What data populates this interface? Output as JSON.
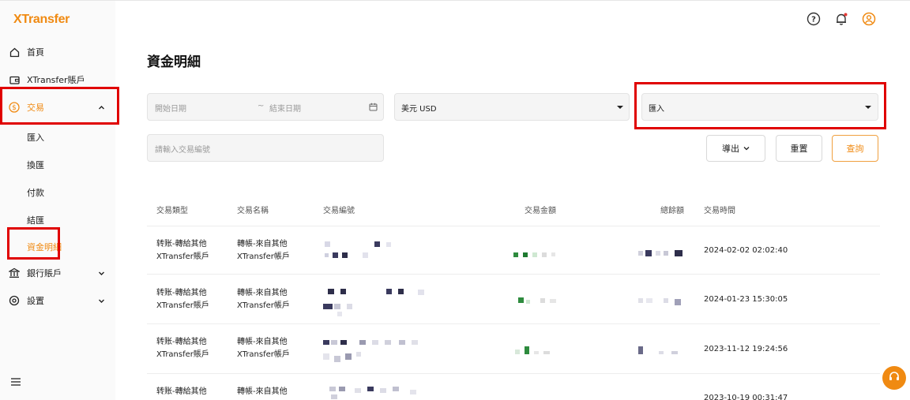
{
  "app": {
    "logo": "XTransfer"
  },
  "sidebar": {
    "items": [
      {
        "label": "首頁",
        "icon": "home-icon"
      },
      {
        "label": "XTransfer賬戶",
        "icon": "wallet-icon"
      },
      {
        "label": "交易",
        "icon": "dollar-circle-icon",
        "active": true,
        "expanded": true
      },
      {
        "label": "銀行賬戶",
        "icon": "bank-icon"
      },
      {
        "label": "設置",
        "icon": "settings-icon"
      }
    ],
    "sub_items": [
      {
        "label": "匯入"
      },
      {
        "label": "換匯"
      },
      {
        "label": "付款"
      },
      {
        "label": "結匯"
      },
      {
        "label": "資金明細",
        "active": true
      }
    ]
  },
  "header": {
    "icons": [
      "help-icon",
      "bell-icon",
      "user-icon"
    ]
  },
  "page": {
    "title": "資金明細"
  },
  "filters": {
    "start_date_placeholder": "開始日期",
    "date_separator": "~",
    "end_date_placeholder": "結束日期",
    "currency_value": "美元 USD",
    "type_value": "匯入",
    "txn_no_placeholder": "請輸入交易編號"
  },
  "buttons": {
    "export": "導出",
    "reset": "重置",
    "query": "查詢"
  },
  "table": {
    "headers": [
      "交易類型",
      "交易名稱",
      "交易編號",
      "交易金額",
      "總餘額",
      "交易時間"
    ],
    "rows": [
      {
        "type_line1": "转账-轉給其他",
        "type_line2": "XTransfer賬戶",
        "name_line1": "轉帳-來自其他",
        "name_line2": "XTransfer帳戶",
        "time": "2024-02-02 02:02:40"
      },
      {
        "type_line1": "转账-轉給其他",
        "type_line2": "XTransfer賬戶",
        "name_line1": "轉帳-來自其他",
        "name_line2": "XTransfer帳戶",
        "time": "2024-01-23 15:30:05"
      },
      {
        "type_line1": "转账-轉給其他",
        "type_line2": "XTransfer賬戶",
        "name_line1": "轉帳-來自其他",
        "name_line2": "XTransfer帳戶",
        "time": "2023-11-12 19:24:56"
      },
      {
        "type_line1": "转账-轉給其他",
        "type_line2": "",
        "name_line1": "轉帳-來自其他",
        "name_line2": "",
        "time": "2023-10-19 00:31:47"
      }
    ]
  },
  "colors": {
    "accent": "#f08a12",
    "highlight": "#e00000"
  }
}
